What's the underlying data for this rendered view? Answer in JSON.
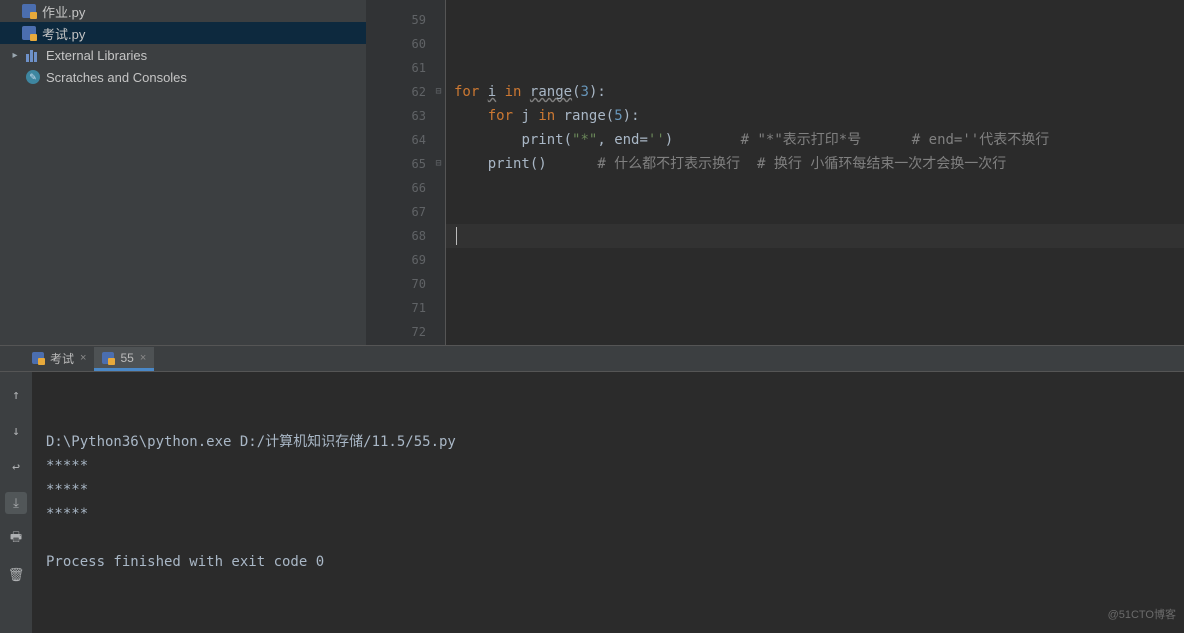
{
  "sidebar": {
    "items": [
      {
        "label": "作业.py",
        "icon": "python",
        "indent": 1,
        "selected": false
      },
      {
        "label": "考试.py",
        "icon": "python",
        "indent": 1,
        "selected": true
      },
      {
        "label": "External Libraries",
        "icon": "libraries",
        "indent": 0,
        "selected": false,
        "expandable": true
      },
      {
        "label": "Scratches and Consoles",
        "icon": "scratch",
        "indent": 0,
        "selected": false
      }
    ]
  },
  "editor": {
    "first_line": 59,
    "line_count": 14,
    "fold_open_at": 62,
    "fold_close_at": 65,
    "cursor_line": 68,
    "lines": {
      "62": [
        {
          "t": "for",
          "c": "kw"
        },
        {
          "t": " ",
          "c": ""
        },
        {
          "t": "i",
          "c": "ident underline"
        },
        {
          "t": " ",
          "c": ""
        },
        {
          "t": "in",
          "c": "kw"
        },
        {
          "t": " ",
          "c": ""
        },
        {
          "t": "range",
          "c": "fn underline"
        },
        {
          "t": "(",
          "c": ""
        },
        {
          "t": "3",
          "c": "num"
        },
        {
          "t": "):",
          "c": ""
        }
      ],
      "63": [
        {
          "t": "    ",
          "c": ""
        },
        {
          "t": "for",
          "c": "kw"
        },
        {
          "t": " ",
          "c": ""
        },
        {
          "t": "j",
          "c": "ident"
        },
        {
          "t": " ",
          "c": ""
        },
        {
          "t": "in",
          "c": "kw"
        },
        {
          "t": " ",
          "c": ""
        },
        {
          "t": "range",
          "c": "fn"
        },
        {
          "t": "(",
          "c": ""
        },
        {
          "t": "5",
          "c": "num"
        },
        {
          "t": "):",
          "c": ""
        }
      ],
      "64": [
        {
          "t": "        ",
          "c": ""
        },
        {
          "t": "print",
          "c": "fn"
        },
        {
          "t": "(",
          "c": ""
        },
        {
          "t": "\"*\"",
          "c": "str"
        },
        {
          "t": ", ",
          "c": ""
        },
        {
          "t": "end",
          "c": "ident"
        },
        {
          "t": "=",
          "c": ""
        },
        {
          "t": "''",
          "c": "str"
        },
        {
          "t": ")        ",
          "c": ""
        },
        {
          "t": "# \"*\"表示打印*号      # end=''代表不换行",
          "c": "cmt"
        }
      ],
      "65": [
        {
          "t": "    ",
          "c": ""
        },
        {
          "t": "print",
          "c": "fn"
        },
        {
          "t": "()      ",
          "c": ""
        },
        {
          "t": "# 什么都不打表示换行  # 换行 小循环每结束一次才会换一次行",
          "c": "cmt"
        }
      ]
    }
  },
  "run_tabs": [
    {
      "label": "考试",
      "active": false
    },
    {
      "label": "55",
      "active": true
    }
  ],
  "console": {
    "lines": [
      "D:\\Python36\\python.exe D:/计算机知识存储/11.5/55.py",
      "*****",
      "*****",
      "*****",
      "",
      "Process finished with exit code 0"
    ]
  },
  "toolbar_icons": [
    "arrow-up",
    "arrow-down",
    "wrap",
    "scroll-to-end",
    "print",
    "trash"
  ],
  "watermark": "@51CTO博客"
}
